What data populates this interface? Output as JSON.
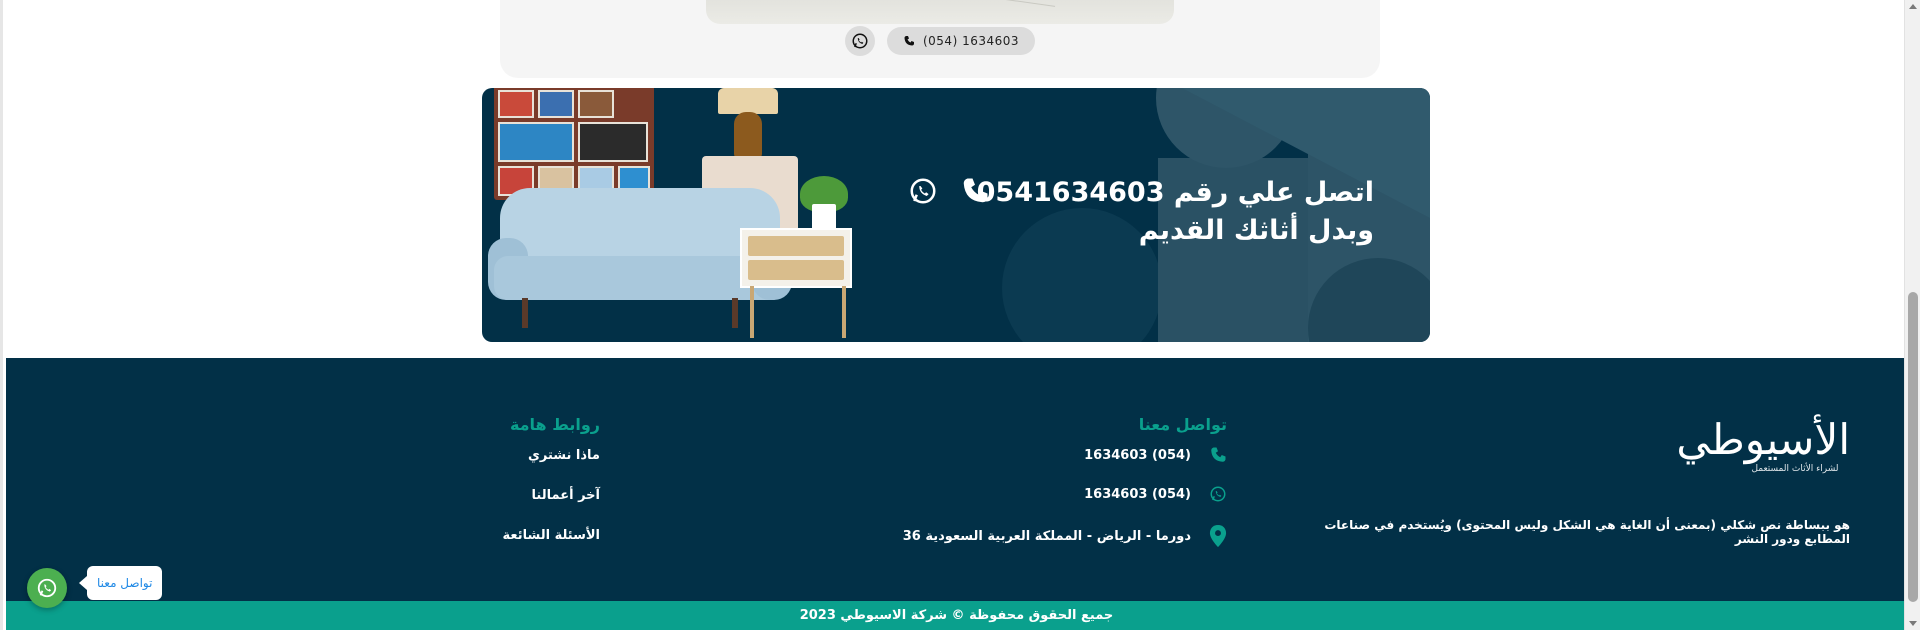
{
  "product_card": {
    "phone": "(054) 1634603"
  },
  "banner": {
    "line1": "اتصل علي رقم 0541634603",
    "line2": "وبدل أثاثك القديم"
  },
  "footer": {
    "logo_text": "الأسيوطي",
    "logo_tagline": "لشراء الأثاث المستعمل",
    "about": "هو ببساطة نص شكلي (بمعنى أن الغاية هي الشكل وليس المحتوى) ويُستخدم في صناعات المطابع ودور النشر",
    "contact": {
      "title": "تواصل معنا",
      "phone": "(054) 1634603",
      "whatsapp": "(054) 1634603",
      "address": "دورما - الرياض - المملكة العربية السعودية 36"
    },
    "links": {
      "title": "روابط هامة",
      "items": [
        "ماذا نشتري",
        "آخر أعمالنا",
        "الأسئلة الشائعة"
      ]
    },
    "copyright": "جميع الحقوق محفوظة © شركة الاسيوطي 2023"
  },
  "floating": {
    "label": "تواصل معنا"
  },
  "colors": {
    "navy": "#023047",
    "teal": "#0aa08d",
    "whatsapp_green": "#4caf50"
  },
  "icons": [
    "whatsapp-icon",
    "phone-icon",
    "map-pin-icon"
  ]
}
